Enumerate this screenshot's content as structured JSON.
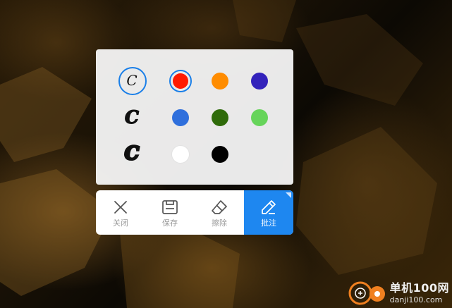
{
  "pens": [
    {
      "glyph": "C",
      "size": "small",
      "selected": true
    },
    {
      "glyph": "C",
      "size": "medium",
      "selected": false
    },
    {
      "glyph": "C",
      "size": "large",
      "selected": false
    }
  ],
  "colors": [
    {
      "name": "red",
      "hex": "#ff1a00",
      "selected": true
    },
    {
      "name": "orange",
      "hex": "#ff8c00",
      "selected": false
    },
    {
      "name": "indigo",
      "hex": "#3322bb",
      "selected": false
    },
    {
      "name": "blue",
      "hex": "#2f6fdc",
      "selected": false
    },
    {
      "name": "dark-green",
      "hex": "#2f6b0a",
      "selected": false
    },
    {
      "name": "light-green",
      "hex": "#66d45a",
      "selected": false
    },
    {
      "name": "white",
      "hex": "#ffffff",
      "selected": false
    },
    {
      "name": "black",
      "hex": "#000000",
      "selected": false
    }
  ],
  "toolbar": {
    "close_label": "关闭",
    "save_label": "保存",
    "erase_label": "擦除",
    "annotate_label": "批注",
    "active": "annotate",
    "accent": "#1e87f0"
  },
  "watermark": {
    "brand_cn": "单机100网",
    "url": "danji100.com"
  }
}
